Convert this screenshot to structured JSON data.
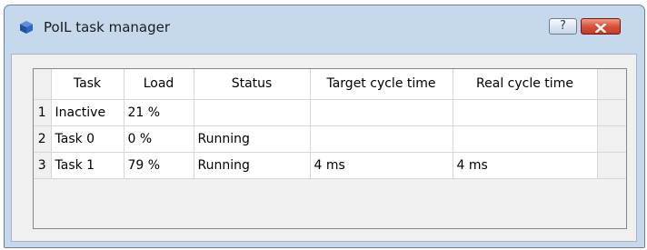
{
  "window": {
    "title": "PoIL task manager",
    "help_label": "?"
  },
  "table": {
    "columns": [
      "Task",
      "Load",
      "Status",
      "Target cycle time",
      "Real cycle time"
    ],
    "rows": [
      {
        "index": "1",
        "task": "Inactive",
        "load": "21 %",
        "status": "",
        "target": "",
        "real": ""
      },
      {
        "index": "2",
        "task": "Task 0",
        "load": "0 %",
        "status": "Running",
        "target": "",
        "real": ""
      },
      {
        "index": "3",
        "task": "Task 1",
        "load": "79 %",
        "status": "Running",
        "target": "4 ms",
        "real": "4 ms"
      }
    ]
  },
  "icons": {
    "app": "cube-icon",
    "help": "question-icon",
    "close": "close-icon"
  },
  "colors": {
    "close_button": "#d9533c",
    "frame": "#c6d8ec",
    "client": "#f0f0f0"
  }
}
